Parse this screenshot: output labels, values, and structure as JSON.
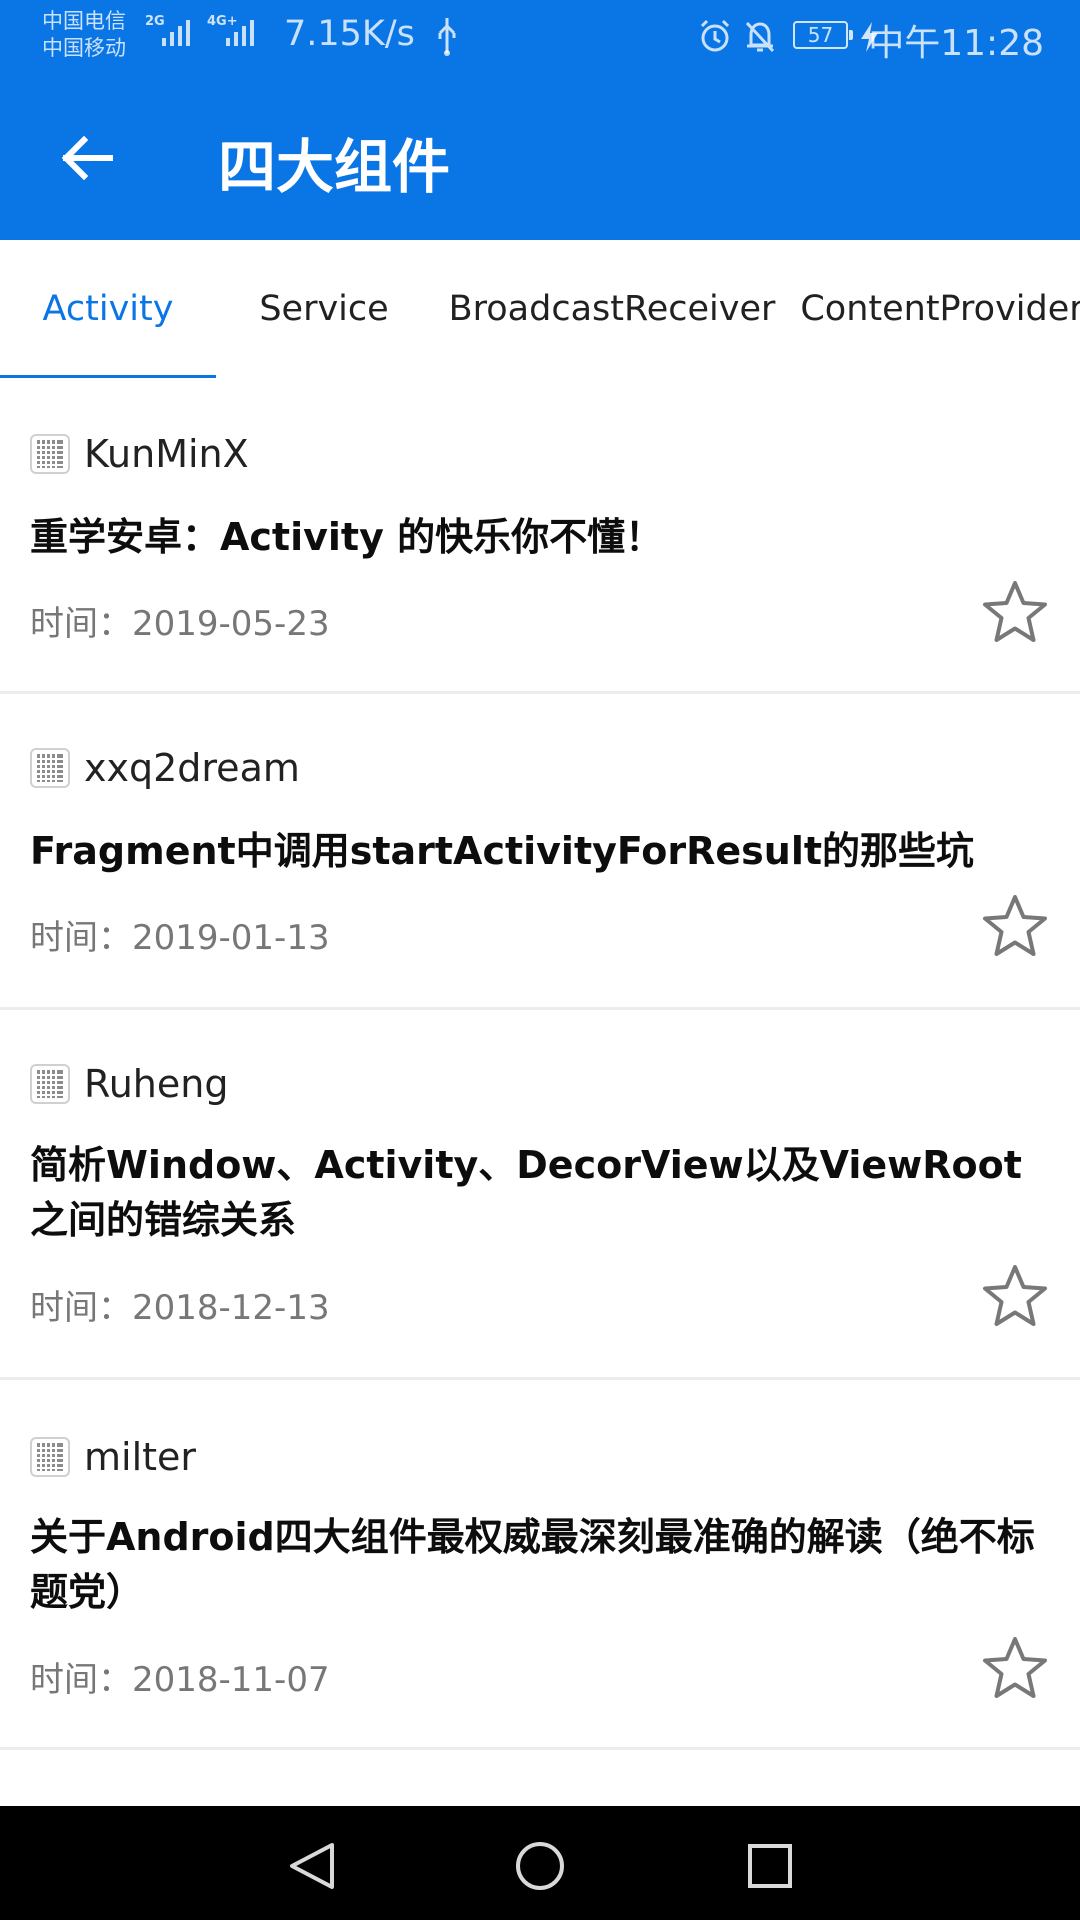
{
  "status_bar": {
    "carrier_1": "中国电信",
    "carrier_2": "中国移动",
    "network_1": "2G",
    "network_2": "4G+",
    "speed": "7.15K/s",
    "battery": "57",
    "time": "中午11:28",
    "icons": [
      "usb-icon",
      "alarm-icon",
      "mute-icon",
      "charging-icon"
    ]
  },
  "app_bar": {
    "title": "四大组件",
    "back_icon": "arrow-left-icon"
  },
  "tabs": [
    {
      "label": "Activity",
      "active": true
    },
    {
      "label": "Service",
      "active": false
    },
    {
      "label": "BroadcastReceiver",
      "active": false
    },
    {
      "label": "ContentProvider",
      "active": false
    }
  ],
  "articles": [
    {
      "author": "KunMinX",
      "title": "重学安卓：Activity 的快乐你不懂！",
      "date": "时间：2019-05-23",
      "favorite": false
    },
    {
      "author": "xxq2dream",
      "title": "Fragment中调用startActivityForResult的那些坑",
      "date": "时间：2019-01-13",
      "favorite": false
    },
    {
      "author": "Ruheng",
      "title": "简析Window、Activity、DecorView以及ViewRoot之间的错综关系",
      "date": "时间：2018-12-13",
      "favorite": false
    },
    {
      "author": "milter",
      "title": "关于Android四大组件最权威最深刻最准确的解读（绝不标题党）",
      "date": "时间：2018-11-07",
      "favorite": false
    }
  ],
  "navigation": {
    "back_icon": "triangle-back-icon",
    "home_icon": "circle-home-icon",
    "recent_icon": "square-recent-icon"
  },
  "colors": {
    "primary": "#0a76e6",
    "text": "#0d0d0d",
    "secondary_text": "#777777",
    "divider": "#ececec",
    "navigation_bar": "#000000"
  }
}
